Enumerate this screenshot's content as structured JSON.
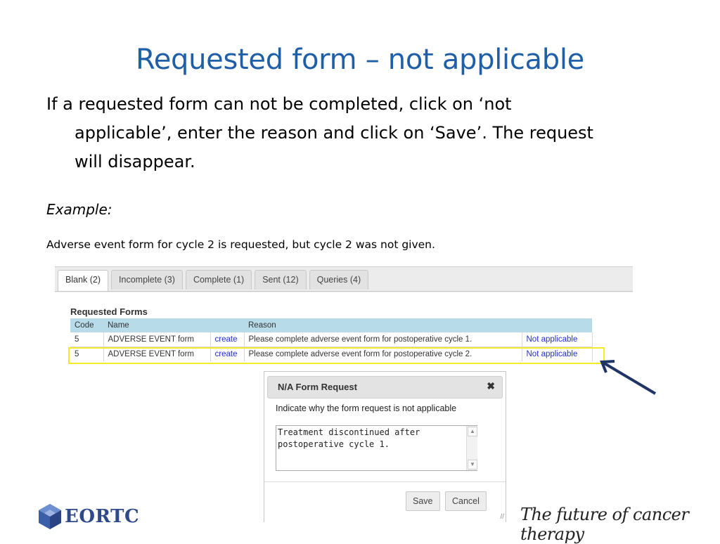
{
  "slide": {
    "title": "Requested form – not applicable",
    "bullet_line1": "If a requested form can not be completed, click on ‘not",
    "bullet_line2": "applicable’, enter the reason and click on ‘Save’.  The request",
    "bullet_line3": "will disappear.",
    "example_label": "Example:",
    "example_text": "Adverse event form for cycle 2 is requested, but cycle 2 was not given."
  },
  "tabs": [
    {
      "label": "Blank (2)",
      "active": true
    },
    {
      "label": "Incomplete (3)"
    },
    {
      "label": "Complete (1)"
    },
    {
      "label": "Sent (12)"
    },
    {
      "label": "Queries (4)"
    }
  ],
  "requested_forms": {
    "heading": "Requested Forms",
    "columns": [
      "Code",
      "Name",
      "",
      "Reason",
      ""
    ],
    "rows": [
      {
        "code": "5",
        "name": "ADVERSE EVENT form",
        "action": "create",
        "reason": "Please complete adverse event form for postoperative cycle 1.",
        "link": "Not applicable"
      },
      {
        "code": "5",
        "name": "ADVERSE EVENT form",
        "action": "create",
        "reason": "Please complete adverse event form for postoperative cycle 2.",
        "link": "Not applicable",
        "highlighted": true
      }
    ]
  },
  "dialog": {
    "title": "N/A Form Request",
    "close": "✖",
    "prompt": "Indicate why the form request is not applicable",
    "reason_value": "Treatment discontinued after postoperative cycle 1.",
    "save_label": "Save",
    "cancel_label": "Cancel"
  },
  "footer": {
    "logo_text": "EORTC",
    "tagline": "The future of cancer therapy"
  },
  "colors": {
    "title": "#1f5fa8",
    "highlight": "#f2ea2a",
    "table_header": "#b7dbe8",
    "link": "#2230c8",
    "arrow": "#1e3566"
  }
}
